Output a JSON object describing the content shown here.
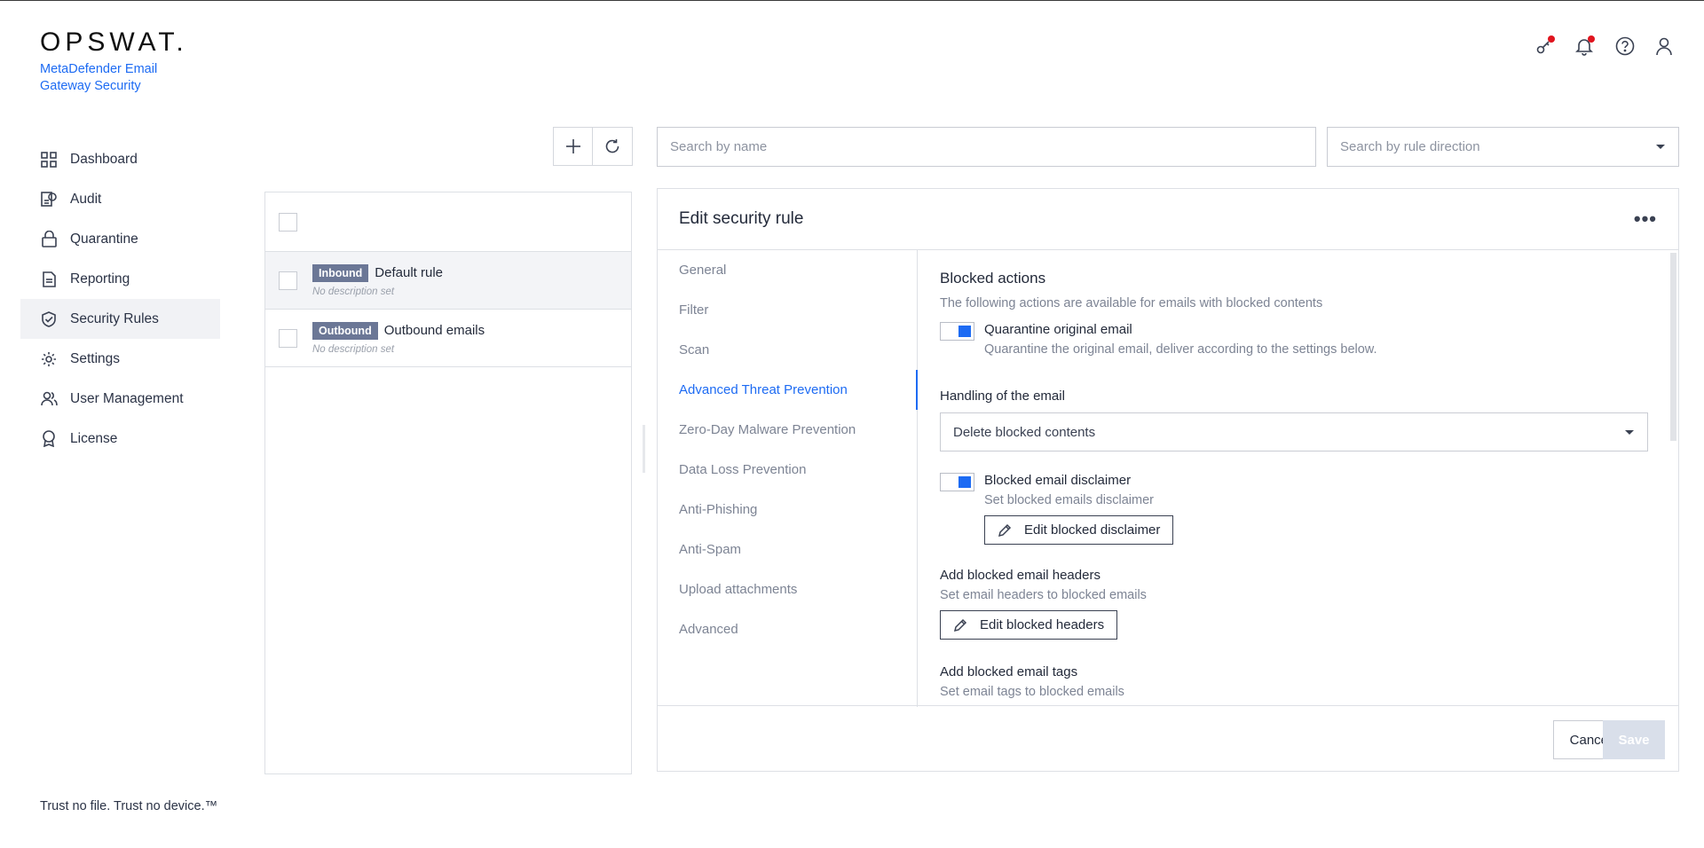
{
  "brand": {
    "logo_text": "OPSWAT.",
    "product_name": "MetaDefender Email Gateway Security",
    "tagline": "Trust no file. Trust no device.™"
  },
  "colors": {
    "accent": "#1d6bf3",
    "badge": "#6b7796",
    "alert_dot": "#e0141e"
  },
  "sidebar": {
    "items": [
      {
        "label": "Dashboard",
        "icon": "dashboard-icon"
      },
      {
        "label": "Audit",
        "icon": "audit-icon"
      },
      {
        "label": "Quarantine",
        "icon": "lock-icon"
      },
      {
        "label": "Reporting",
        "icon": "report-icon"
      },
      {
        "label": "Security Rules",
        "icon": "shield-check-icon",
        "active": true
      },
      {
        "label": "Settings",
        "icon": "gear-icon"
      },
      {
        "label": "User Management",
        "icon": "users-icon"
      },
      {
        "label": "License",
        "icon": "badge-icon"
      }
    ]
  },
  "header_icons": [
    "key-icon",
    "bell-icon",
    "help-icon",
    "user-icon"
  ],
  "search": {
    "name_placeholder": "Search by name",
    "direction_placeholder": "Search by rule direction"
  },
  "rules": [
    {
      "direction": "Inbound",
      "name": "Default rule",
      "description": "No description set",
      "selected": true
    },
    {
      "direction": "Outbound",
      "name": "Outbound emails",
      "description": "No description set"
    }
  ],
  "edit_panel": {
    "title": "Edit security rule",
    "tabs": [
      "General",
      "Filter",
      "Scan",
      "Advanced Threat Prevention",
      "Zero-Day Malware Prevention",
      "Data Loss Prevention",
      "Anti-Phishing",
      "Anti-Spam",
      "Upload attachments",
      "Advanced"
    ],
    "active_tab": "Advanced Threat Prevention",
    "content": {
      "section_title": "Blocked actions",
      "section_desc": "The following actions are available for emails with blocked contents",
      "quarantine_label": "Quarantine original email",
      "quarantine_desc": "Quarantine the original email, deliver according to the settings below.",
      "handling_label": "Handling of the email",
      "handling_value": "Delete blocked contents",
      "disclaimer_label": "Blocked email disclaimer",
      "disclaimer_desc": "Set blocked emails disclaimer",
      "disclaimer_button": "Edit blocked disclaimer",
      "headers_label": "Add blocked email headers",
      "headers_desc": "Set email headers to blocked emails",
      "headers_button": "Edit blocked headers",
      "tags_label": "Add blocked email tags",
      "tags_desc": "Set email tags to blocked emails"
    },
    "cancel_label": "Cancel",
    "save_label": "Save"
  }
}
